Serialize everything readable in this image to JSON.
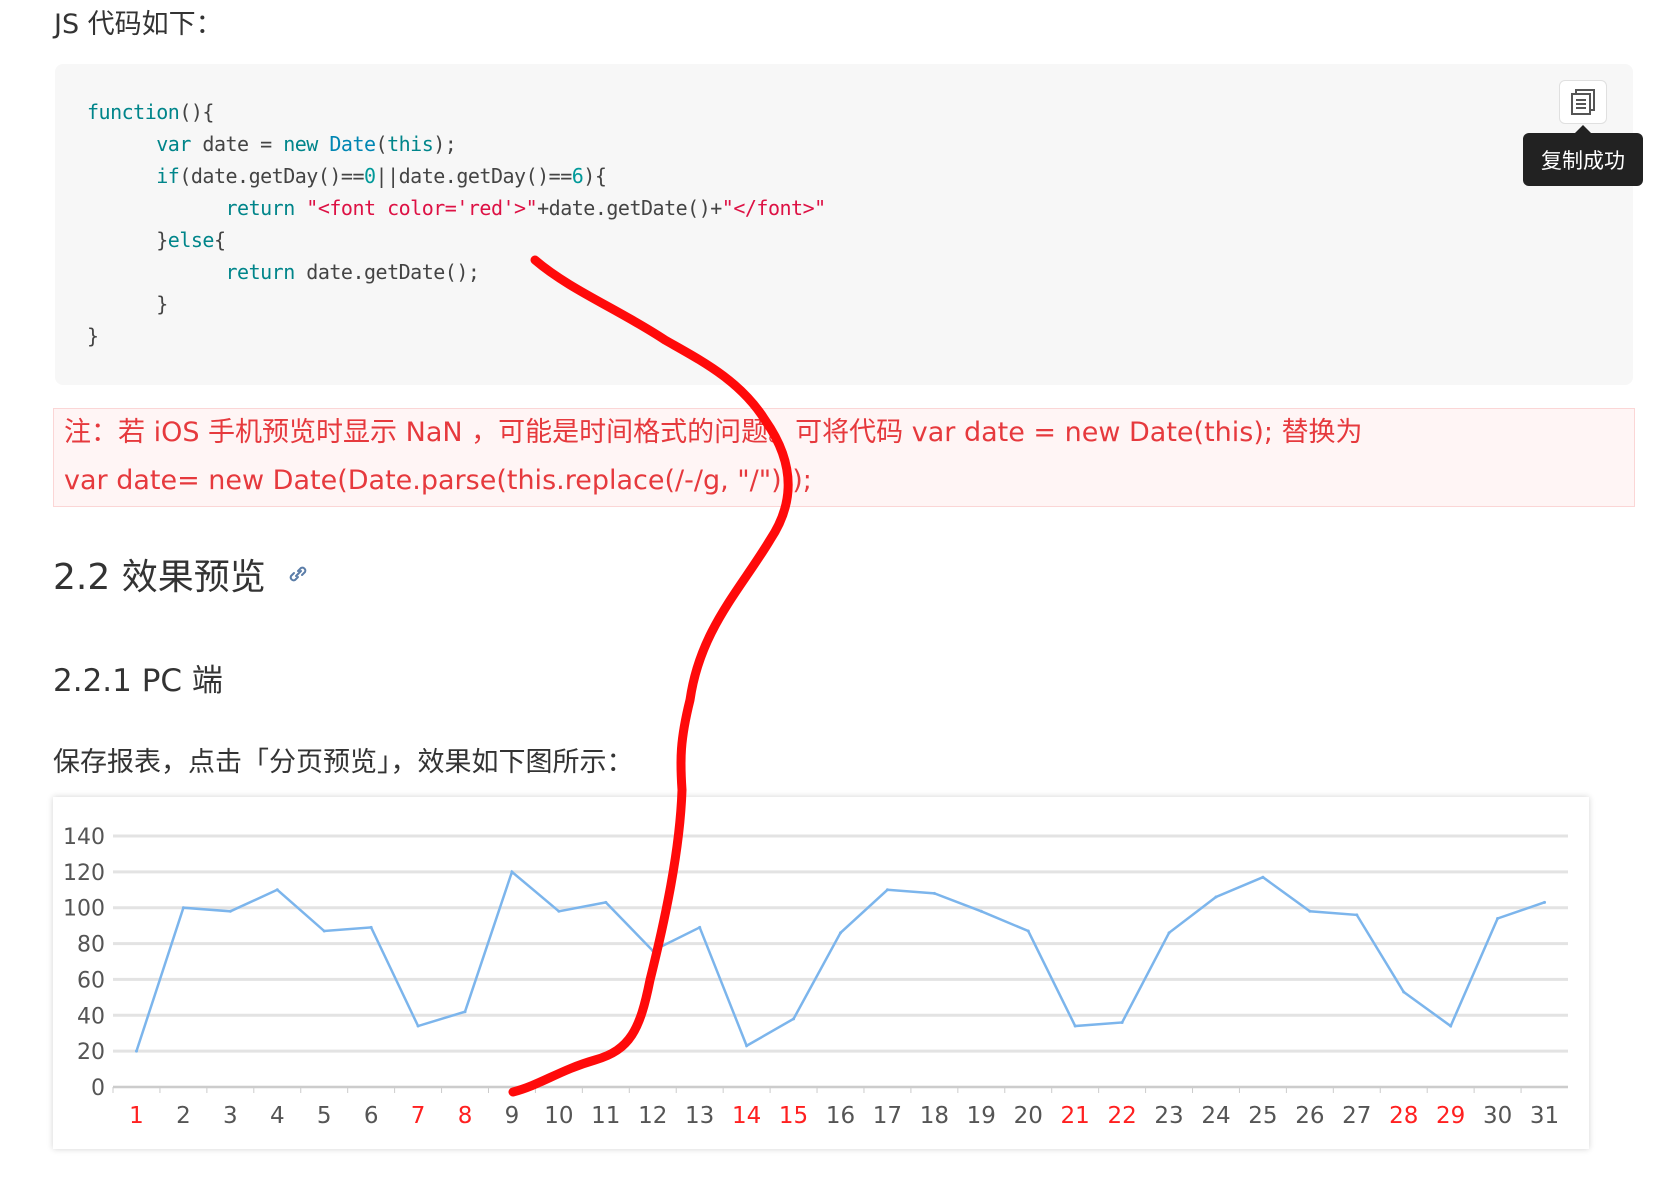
{
  "intro": "JS 代码如下：",
  "code": {
    "lines": [
      [
        [
          "kw",
          "function"
        ],
        [
          "",
          "(){"
        ]
      ],
      [
        [
          "",
          "      "
        ],
        [
          "kw",
          "var"
        ],
        [
          "",
          " date = "
        ],
        [
          "kw",
          "new"
        ],
        [
          "",
          " "
        ],
        [
          "bi",
          "Date"
        ],
        [
          "",
          "("
        ],
        [
          "kw",
          "this"
        ],
        [
          "",
          ");"
        ]
      ],
      [
        [
          "",
          "      "
        ],
        [
          "kw",
          "if"
        ],
        [
          "",
          "(date.getDay()=="
        ],
        [
          "nm",
          "0"
        ],
        [
          "",
          "||date.getDay()=="
        ],
        [
          "nm",
          "6"
        ],
        [
          "",
          "){"
        ]
      ],
      [
        [
          "",
          "            "
        ],
        [
          "kw",
          "return"
        ],
        [
          "",
          " "
        ],
        [
          "st",
          "\"<font color='red'>\""
        ],
        [
          "",
          "+date.getDate()+"
        ],
        [
          "st",
          "\"</font>\""
        ]
      ],
      [
        [
          "",
          "      }"
        ],
        [
          "kw",
          "else"
        ],
        [
          "",
          "{"
        ]
      ],
      [
        [
          "",
          "            "
        ],
        [
          "kw",
          "return"
        ],
        [
          "",
          " date.getDate();"
        ]
      ],
      [
        [
          "",
          "      }"
        ]
      ],
      [
        [
          "",
          "}"
        ]
      ]
    ],
    "copy_tooltip": "复制成功"
  },
  "note": {
    "line1": "注：若 iOS 手机预览时显示 NaN ，可能是时间格式的问题。可将代码 var date = new Date(this); 替换为",
    "line2": "var date= new Date(Date.parse(this.replace(/-/g,  \"/\")));"
  },
  "heading_22": "2.2 效果预览",
  "heading_221": "2.2.1 PC 端",
  "paragraph": "保存报表，点击「分页预览」，效果如下图所示：",
  "chart_data": {
    "type": "line",
    "categories": [
      "1",
      "2",
      "3",
      "4",
      "5",
      "6",
      "7",
      "8",
      "9",
      "10",
      "11",
      "12",
      "13",
      "14",
      "15",
      "16",
      "17",
      "18",
      "19",
      "20",
      "21",
      "22",
      "23",
      "24",
      "25",
      "26",
      "27",
      "28",
      "29",
      "30",
      "31"
    ],
    "weekend_categories": [
      "1",
      "7",
      "8",
      "14",
      "15",
      "21",
      "22",
      "28",
      "29"
    ],
    "values": [
      20,
      100,
      98,
      110,
      87,
      89,
      34,
      42,
      120,
      98,
      103,
      76,
      89,
      23,
      38,
      86,
      110,
      108,
      98,
      87,
      34,
      36,
      86,
      106,
      117,
      98,
      96,
      53,
      34,
      94,
      103
    ],
    "ylim": [
      0,
      140
    ],
    "yticks": [
      0,
      20,
      40,
      60,
      80,
      100,
      120,
      140
    ],
    "grid": true,
    "line_color": "#7cb5ec",
    "weekend_color": "#ff2020"
  }
}
